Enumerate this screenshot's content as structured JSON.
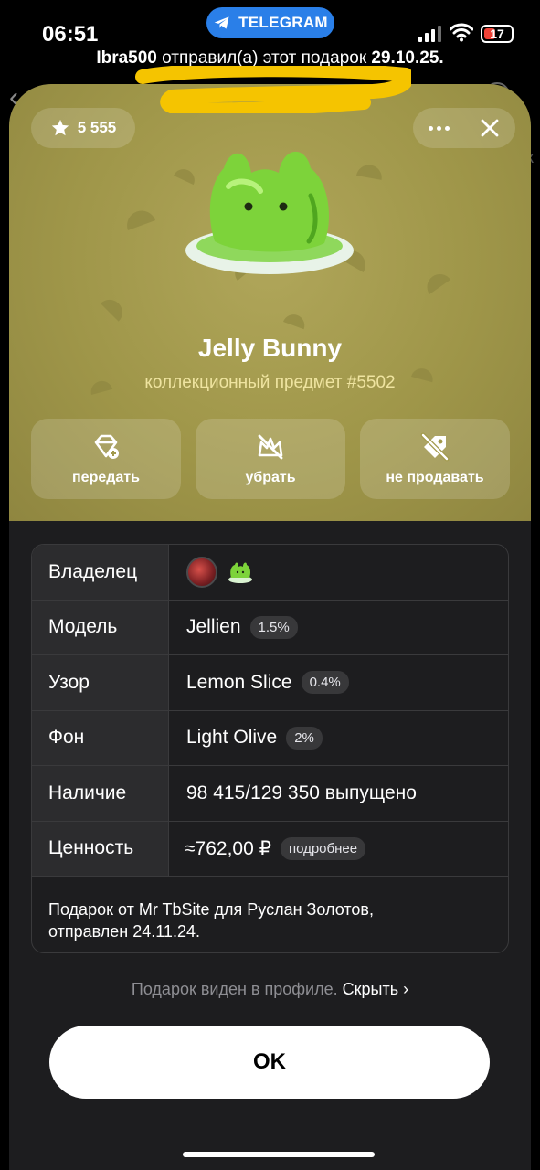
{
  "status_bar": {
    "time": "06:51",
    "app_pill": "TELEGRAM",
    "battery": "17"
  },
  "banner": {
    "sender": "Ibra500",
    "middle": " отправил(а) этот подарок ",
    "date": "29.10.25."
  },
  "sheet": {
    "stars": "5 555",
    "gift_name": "Jelly Bunny",
    "gift_subtitle": "коллекционный предмет #5502",
    "actions": [
      {
        "label": "передать",
        "icon": "transfer-gift-icon"
      },
      {
        "label": "убрать",
        "icon": "hide-icon"
      },
      {
        "label": "не продавать",
        "icon": "unlist-tag-icon"
      }
    ],
    "table": {
      "owner_label": "Владелец",
      "model_label": "Модель",
      "model_value": "Jellien",
      "model_badge": "1.5%",
      "pattern_label": "Узор",
      "pattern_value": "Lemon Slice",
      "pattern_badge": "0.4%",
      "background_label": "Фон",
      "background_value": "Light Olive",
      "background_badge": "2%",
      "availability_label": "Наличие",
      "availability_value": "98 415/129 350 выпущено",
      "value_label": "Ценность",
      "value_value": "≈762,00 ₽",
      "value_badge": "подробнее",
      "note_line1": "Подарок от Mr TbSite для Руслан Золотов,",
      "note_line2": "отправлен 24.11.24."
    },
    "visibility_text": "Подарок виден в профиле.",
    "visibility_link": "Скрыть",
    "ok_label": "OK"
  },
  "colors": {
    "hero_background": "#9f9649",
    "subtitle": "#efe4a0",
    "telegram_pill": "#2a7fe8",
    "highlight_scribble": "#f5c400"
  }
}
